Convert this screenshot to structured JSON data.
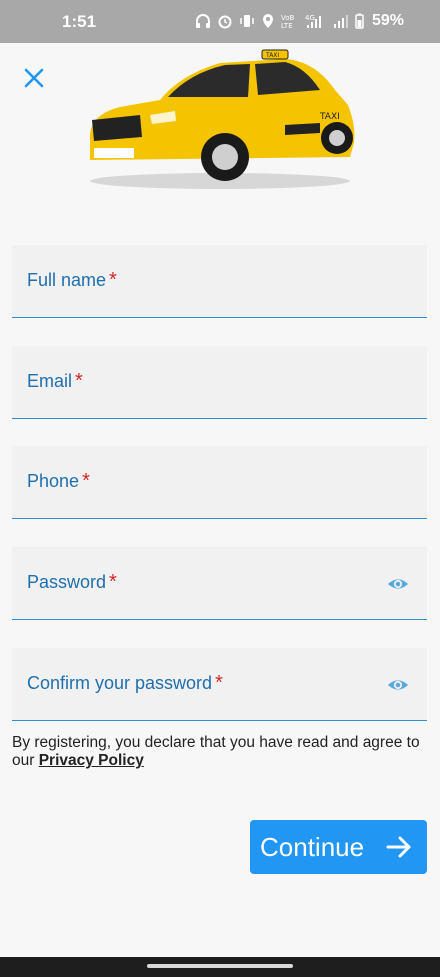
{
  "status_bar": {
    "time": "1:51",
    "battery": "59%",
    "icons": [
      "headphones-icon",
      "alarm-icon",
      "vibrate-icon",
      "location-icon",
      "volte-icon",
      "signal-4g-icon",
      "signal-icon",
      "battery-icon"
    ]
  },
  "header": {
    "close_icon": "close-icon",
    "image": "yellow-taxi-car"
  },
  "form": {
    "full_name": {
      "label": "Full name",
      "required": "*",
      "value": ""
    },
    "email": {
      "label": "Email",
      "required": "*",
      "value": ""
    },
    "phone": {
      "label": "Phone",
      "required": "*",
      "value": ""
    },
    "password": {
      "label": "Password",
      "required": "*",
      "value": "",
      "icon": "eye-icon"
    },
    "confirm_password": {
      "label": "Confirm your password",
      "required": "*",
      "value": "",
      "icon": "eye-icon"
    }
  },
  "consent": {
    "text": "By registering, you declare that you have read and agree to our ",
    "link": "Privacy Policy"
  },
  "continue_button": {
    "label": "Continue",
    "icon": "arrow-right-icon"
  },
  "colors": {
    "accent": "#2196f3",
    "label": "#1f6fae",
    "required": "#d32727",
    "taxi_yellow": "#f5c400"
  }
}
